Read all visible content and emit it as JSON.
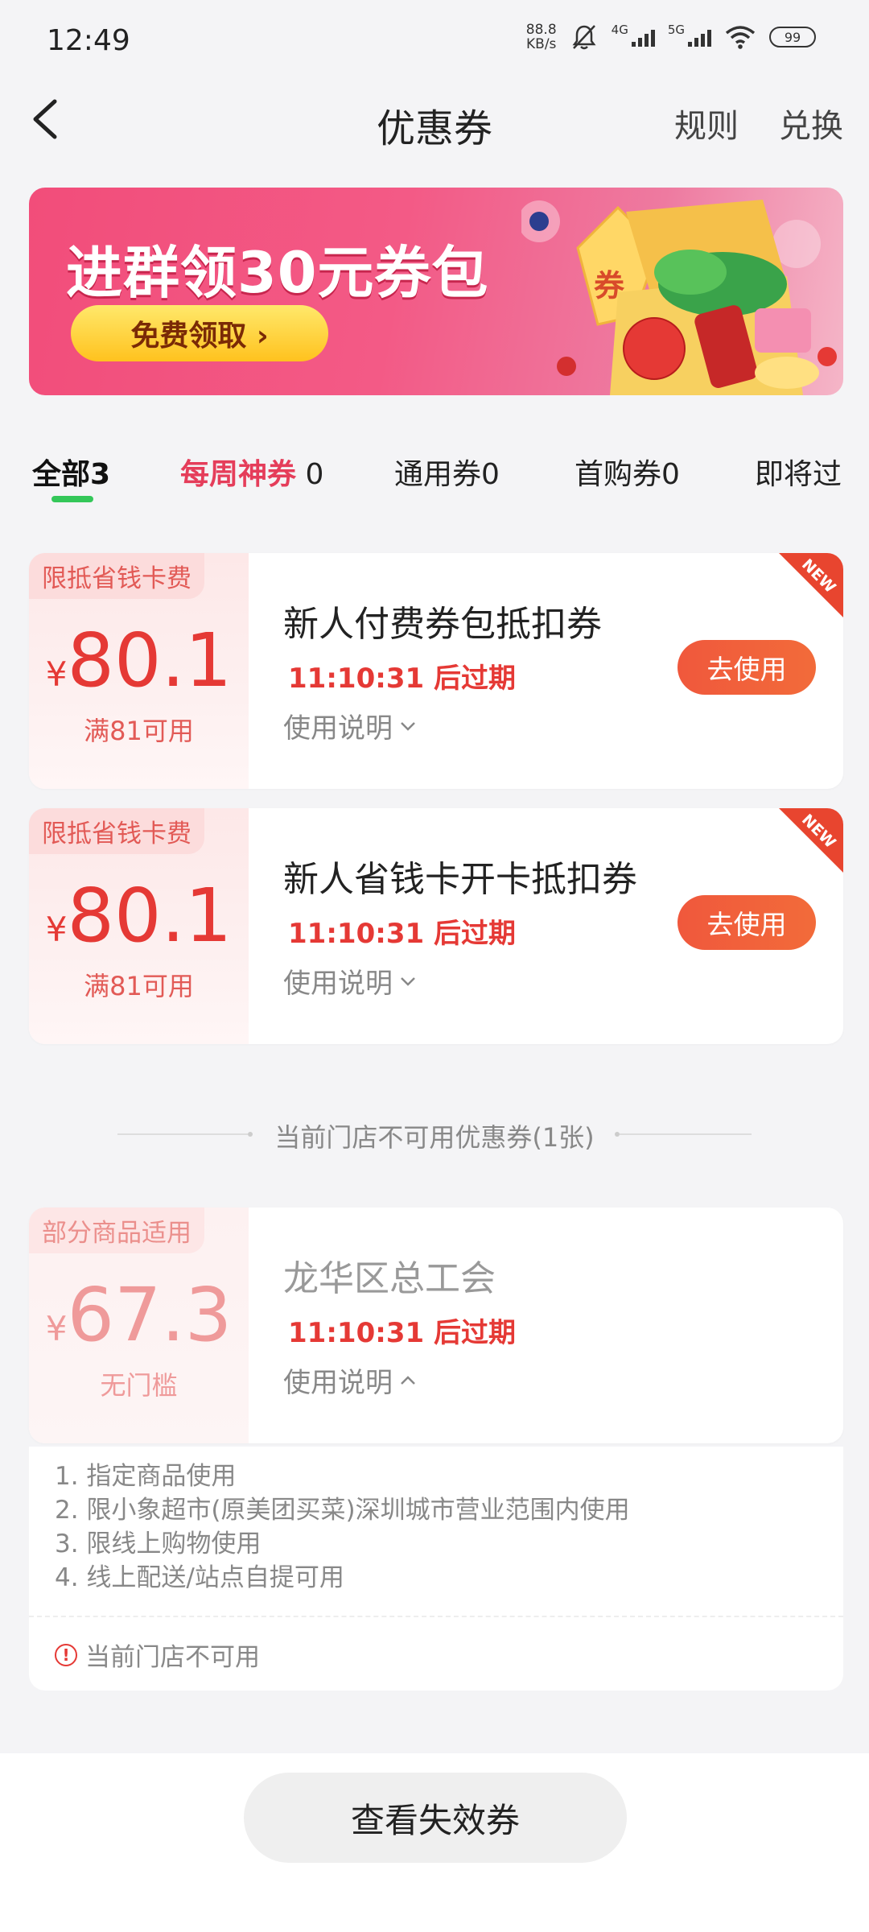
{
  "status_bar": {
    "time": "12:49",
    "net_speed_value": "88.8",
    "net_speed_unit": "KB/s",
    "signal_1_label": "4G",
    "signal_2_label": "5G",
    "battery": "99"
  },
  "header": {
    "title": "优惠券",
    "rules_label": "规则",
    "exchange_label": "兑换"
  },
  "banner": {
    "headline": "进群领30元券包",
    "button_label": "免费领取 ›",
    "art_text": "券"
  },
  "tabs": [
    {
      "label": "全部",
      "count": "3",
      "active": true
    },
    {
      "label": "每周神券",
      "count": "0"
    },
    {
      "label": "通用券",
      "count": "0"
    },
    {
      "label": "首购券",
      "count": "0"
    },
    {
      "label": "即将过"
    }
  ],
  "coupons": [
    {
      "tag": "限抵省钱卡费",
      "currency": "¥",
      "amount": "80.1",
      "condition": "满81可用",
      "name": "新人付费券包抵扣券",
      "expire": "11:10:31 后过期",
      "usage_label": "使用说明",
      "action_label": "去使用",
      "ribbon": "NEW"
    },
    {
      "tag": "限抵省钱卡费",
      "currency": "¥",
      "amount": "80.1",
      "condition": "满81可用",
      "name": "新人省钱卡开卡抵扣券",
      "expire": "11:10:31 后过期",
      "usage_label": "使用说明",
      "action_label": "去使用",
      "ribbon": "NEW"
    }
  ],
  "unavailable_section": {
    "divider_text": "当前门店不可用优惠券(1张)",
    "coupon": {
      "tag": "部分商品适用",
      "currency": "¥",
      "amount": "67.3",
      "condition": "无门槛",
      "name": "龙华区总工会",
      "expire": "11:10:31 后过期",
      "usage_label": "使用说明"
    },
    "details": [
      "1. 指定商品使用",
      "2. 限小象超市(原美团买菜)深圳城市营业范围内使用",
      "3. 限线上购物使用",
      "4. 线上配送/站点自提可用"
    ],
    "unavailable_note": "当前门店不可用"
  },
  "footer": {
    "view_expired_label": "查看失效券"
  },
  "colors": {
    "accent_red": "#e53935",
    "tab_underline": "#34c759",
    "button_orange": "#f0583c",
    "banner_pink": "#f24d7a"
  }
}
